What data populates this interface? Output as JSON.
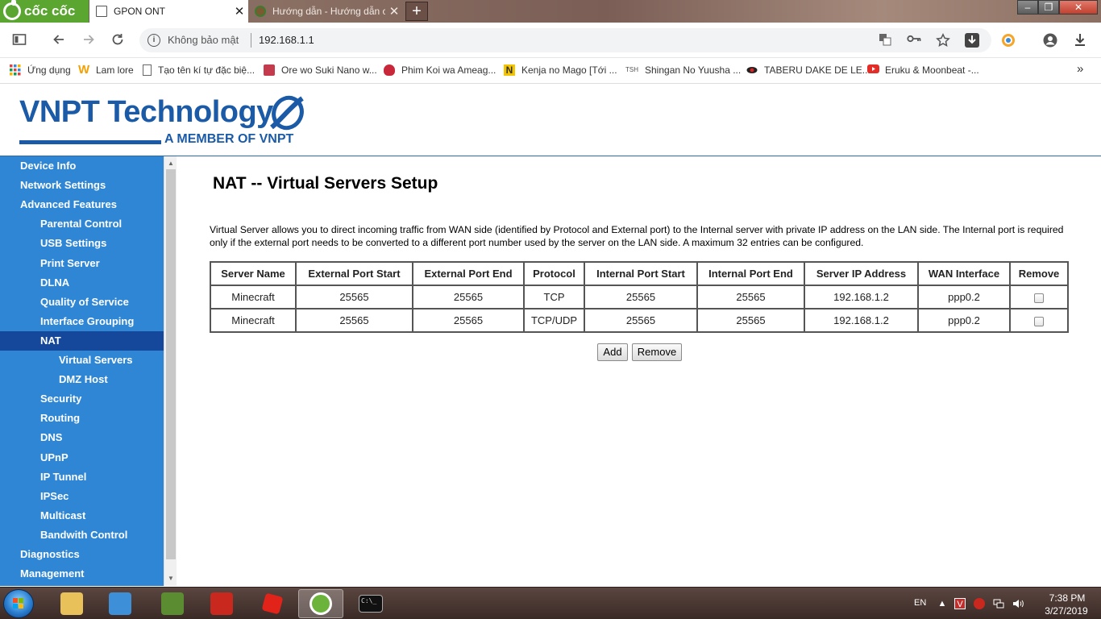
{
  "browser": {
    "brand": "cốc cốc",
    "tabs": [
      {
        "title": "GPON ONT",
        "close": "✕"
      },
      {
        "title": "Hướng dẫn - Hướng dẫn c",
        "close": "✕"
      }
    ],
    "new_tab": "+",
    "window_controls": {
      "minimize": "–",
      "maximize": "❐",
      "close": "✕"
    },
    "security_text": "Không bảo mật",
    "url": "192.168.1.1",
    "bookmarks": [
      {
        "label": "Ứng dụng",
        "icon": "apps-grid-icon"
      },
      {
        "label": "Lam lore",
        "icon": "w-logo-icon"
      },
      {
        "label": "Tạo tên kí tự đặc biệ...",
        "icon": "page-icon"
      },
      {
        "label": "Ore wo Suki Nano w...",
        "icon": "book-icon"
      },
      {
        "label": "Phim Koi wa Ameag...",
        "icon": "anime-icon"
      },
      {
        "label": "Kenja no Mago [Tới ...",
        "icon": "n-logo-icon"
      },
      {
        "label": "Shingan No Yuusha ...",
        "icon": "tsh-icon"
      },
      {
        "label": "TABERU DAKE DE LE...",
        "icon": "eye-icon"
      },
      {
        "label": "Eruku & Moonbeat -...",
        "icon": "youtube-icon"
      }
    ],
    "bookmarks_overflow": "»",
    "bookmark_tsh_text": "TSH"
  },
  "router": {
    "logo_name": "VNPT Technology",
    "logo_tagline": "A MEMBER OF VNPT",
    "menu": [
      {
        "label": "Device Info",
        "level": 0
      },
      {
        "label": "Network Settings",
        "level": 0
      },
      {
        "label": "Advanced Features",
        "level": 0
      },
      {
        "label": "Parental Control",
        "level": 1
      },
      {
        "label": "USB Settings",
        "level": 1
      },
      {
        "label": "Print Server",
        "level": 1
      },
      {
        "label": "DLNA",
        "level": 1
      },
      {
        "label": "Quality of Service",
        "level": 1
      },
      {
        "label": "Interface Grouping",
        "level": 1
      },
      {
        "label": "NAT",
        "level": 1,
        "active": true
      },
      {
        "label": "Virtual Servers",
        "level": 2
      },
      {
        "label": "DMZ Host",
        "level": 2
      },
      {
        "label": "Security",
        "level": 1
      },
      {
        "label": "Routing",
        "level": 1
      },
      {
        "label": "DNS",
        "level": 1
      },
      {
        "label": "UPnP",
        "level": 1
      },
      {
        "label": "IP Tunnel",
        "level": 1
      },
      {
        "label": "IPSec",
        "level": 1
      },
      {
        "label": "Multicast",
        "level": 1
      },
      {
        "label": "Bandwith Control",
        "level": 1
      },
      {
        "label": "Diagnostics",
        "level": 0
      },
      {
        "label": "Management",
        "level": 0
      }
    ],
    "page_title": "NAT -- Virtual Servers Setup",
    "description": "Virtual Server allows you to direct incoming traffic from WAN side (identified by Protocol and External port) to the Internal server with private IP address on the LAN side. The Internal port is required only if the external port needs to be converted to a different port number used by the server on the LAN side. A maximum 32 entries can be configured.",
    "table": {
      "headers": [
        "Server Name",
        "External Port Start",
        "External Port End",
        "Protocol",
        "Internal Port Start",
        "Internal Port End",
        "Server IP Address",
        "WAN Interface",
        "Remove"
      ],
      "rows": [
        [
          "Minecraft",
          "25565",
          "25565",
          "TCP",
          "25565",
          "25565",
          "192.168.1.2",
          "ppp0.2"
        ],
        [
          "Minecraft",
          "25565",
          "25565",
          "TCP/UDP",
          "25565",
          "25565",
          "192.168.1.2",
          "ppp0.2"
        ]
      ]
    },
    "buttons": {
      "add": "Add",
      "remove": "Remove"
    }
  },
  "taskbar": {
    "apps": [
      {
        "name": "file-explorer",
        "color": "#e8c15a"
      },
      {
        "name": "media-player",
        "color": "#3d8fd8"
      },
      {
        "name": "minecraft",
        "color": "#5b8c32"
      },
      {
        "name": "garena",
        "color": "#c8281e"
      },
      {
        "name": "roblox",
        "color": "#e2231a"
      },
      {
        "name": "coccoc-browser",
        "color": "#6bb33a",
        "active": true
      },
      {
        "name": "command-prompt",
        "color": "#111111"
      }
    ],
    "cmd_label": "C:\\_",
    "tray_lang": "EN",
    "time": "7:38 PM",
    "date": "3/27/2019"
  },
  "colors": {
    "sidebar_bg": "#2e86d5",
    "sidebar_active": "#15479b",
    "logo_blue": "#1a5aa6",
    "coccoc_green": "#5aa631"
  }
}
